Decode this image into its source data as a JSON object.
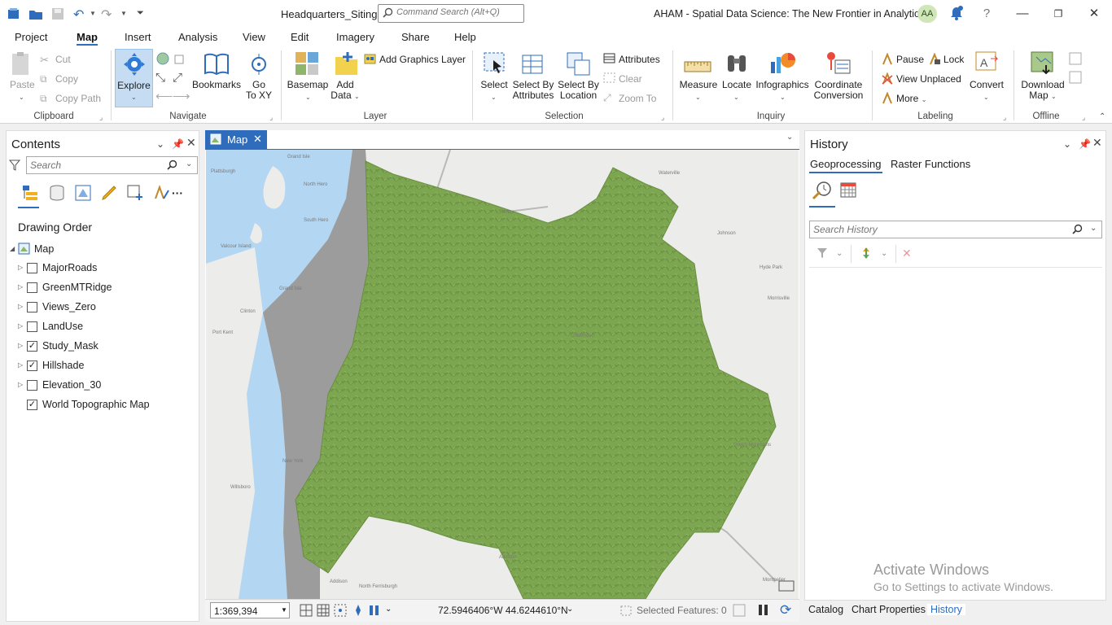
{
  "titlebar": {
    "project": "Headquarters_Siting",
    "command_search_placeholder": "Command Search (Alt+Q)",
    "app_title": "AHAM - Spatial Data Science:  The New Frontier in Analytics",
    "user_initials": "AA",
    "help": "?"
  },
  "menu_tabs": [
    "Project",
    "Map",
    "Insert",
    "Analysis",
    "View",
    "Edit",
    "Imagery",
    "Share",
    "Help"
  ],
  "ribbon": {
    "clipboard": {
      "paste": "Paste",
      "cut": "Cut",
      "copy": "Copy",
      "copy_path": "Copy Path",
      "label": "Clipboard"
    },
    "navigate": {
      "explore": "Explore",
      "bookmarks": "Bookmarks",
      "go_to_xy_1": "Go",
      "go_to_xy_2": "To XY",
      "label": "Navigate"
    },
    "layer": {
      "basemap": "Basemap",
      "add_data_1": "Add",
      "add_data_2": "Data",
      "add_graphics_layer": "Add Graphics Layer",
      "label": "Layer"
    },
    "selection": {
      "select": "Select",
      "select_by_attr_1": "Select By",
      "select_by_attr_2": "Attributes",
      "select_by_loc_1": "Select By",
      "select_by_loc_2": "Location",
      "attributes": "Attributes",
      "clear": "Clear",
      "zoom_to": "Zoom To",
      "label": "Selection"
    },
    "inquiry": {
      "measure": "Measure",
      "locate": "Locate",
      "infographics": "Infographics",
      "coord_1": "Coordinate",
      "coord_2": "Conversion",
      "label": "Inquiry"
    },
    "labeling": {
      "pause": "Pause",
      "lock": "Lock",
      "view_unplaced": "View Unplaced",
      "more": "More",
      "convert": "Convert",
      "label": "Labeling"
    },
    "offline": {
      "download_1": "Download",
      "download_2": "Map",
      "label": "Offline"
    }
  },
  "contents": {
    "title": "Contents",
    "search_placeholder": "Search",
    "drawing_order": "Drawing Order",
    "map_name": "Map",
    "layers": [
      {
        "name": "MajorRoads",
        "checked": false,
        "expandable": true
      },
      {
        "name": "GreenMTRidge",
        "checked": false,
        "expandable": true
      },
      {
        "name": "Views_Zero",
        "checked": false,
        "expandable": true
      },
      {
        "name": "LandUse",
        "checked": false,
        "expandable": true
      },
      {
        "name": "Study_Mask",
        "checked": true,
        "expandable": true
      },
      {
        "name": "Hillshade",
        "checked": true,
        "expandable": true
      },
      {
        "name": "Elevation_30",
        "checked": false,
        "expandable": true
      },
      {
        "name": "World Topographic Map",
        "checked": true,
        "expandable": false
      }
    ]
  },
  "map": {
    "tab": "Map",
    "labels": [
      "Plattsburgh",
      "Grand Isle",
      "Valcour Island",
      "South Hero",
      "North Hero",
      "Fairfax",
      "Waterville",
      "Johnson",
      "Hyde Park",
      "Morrisville",
      "Grand Isle",
      "Clinton",
      "Port Kent",
      "New York",
      "Willsboro",
      "Addison",
      "North Ferrisburgh",
      "Addison",
      "Chittenden",
      "Green Mountains",
      "Montpelier"
    ],
    "scale": "1:369,394",
    "coordinates": "72.5946406°W 44.6244610°N",
    "selected_features": "Selected Features: 0"
  },
  "history": {
    "title": "History",
    "tabs": [
      "Geoprocessing",
      "Raster Functions"
    ],
    "search_placeholder": "Search History"
  },
  "bottom_tabs": [
    "Catalog",
    "Chart Properties",
    "History"
  ],
  "watermark": {
    "line1": "Activate Windows",
    "line2": "Go to Settings to activate Windows."
  },
  "colors": {
    "accent": "#2f6dbc",
    "hillshade_green": "#7da650",
    "water": "#b3d6f2",
    "mask_gray": "#9c9c9c"
  }
}
